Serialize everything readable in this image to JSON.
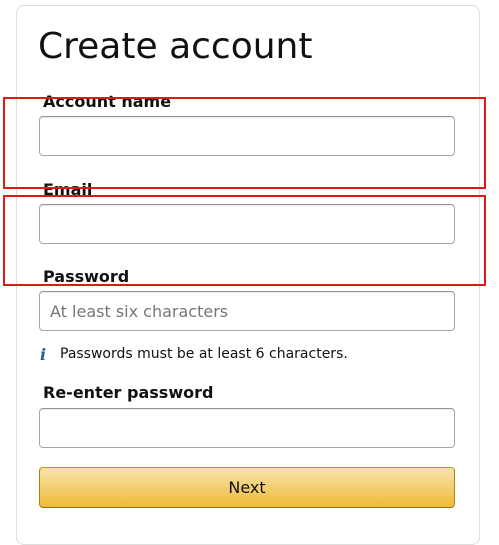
{
  "form": {
    "title": "Create account",
    "account_name": {
      "label": "Account name",
      "value": "",
      "placeholder": ""
    },
    "email": {
      "label": "Email",
      "value": "",
      "placeholder": ""
    },
    "password": {
      "label": "Password",
      "value": "",
      "placeholder": "At least six characters",
      "hint_icon": "i",
      "hint": "Passwords must be at least 6 characters."
    },
    "reenter_password": {
      "label": "Re-enter password",
      "value": "",
      "placeholder": ""
    },
    "next_label": "Next"
  },
  "colors": {
    "highlight": "#e01818",
    "button_top": "#f8e3ad",
    "button_bottom": "#eeba37",
    "info_icon": "#2162a1"
  },
  "icons": {
    "hint": "info-icon"
  }
}
